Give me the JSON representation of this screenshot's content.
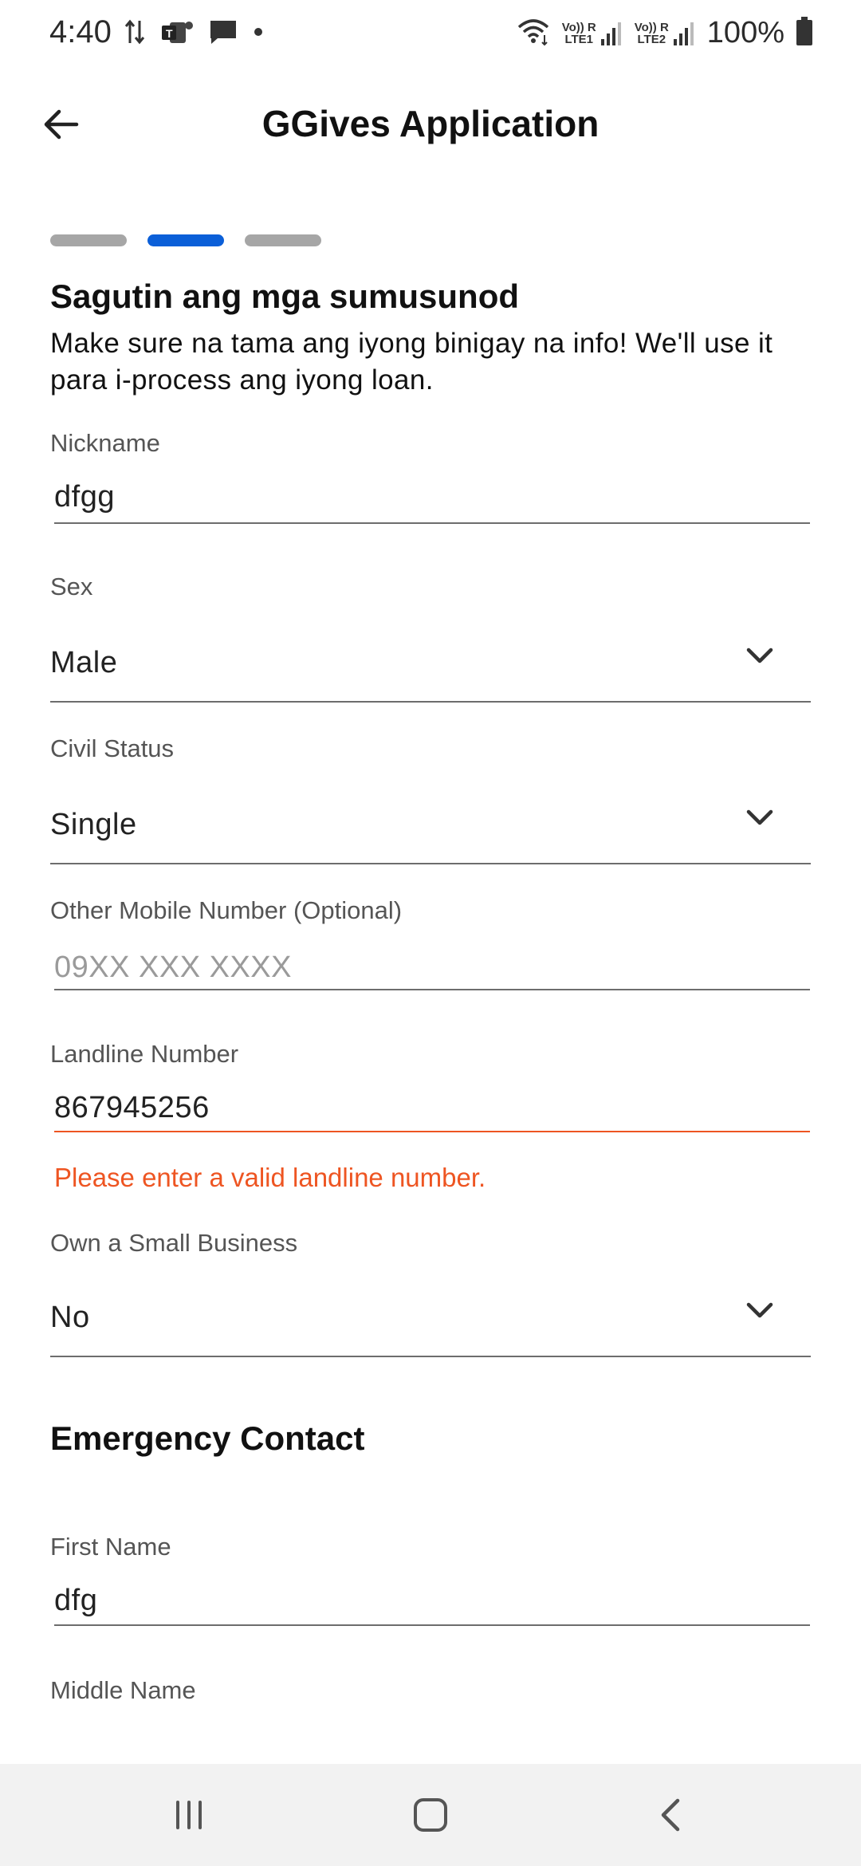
{
  "status_bar": {
    "time": "4:40",
    "battery": "100%",
    "sim1_label": "Vo)) R\nLTE1",
    "sim2_label": "Vo)) R\nLTE2",
    "left_icons": [
      "data-transfer-icon",
      "teams-icon",
      "message-icon",
      "dot-icon"
    ],
    "right_icons": [
      "wifi-icon",
      "signal-icon",
      "signal-icon",
      "battery-icon"
    ]
  },
  "app_bar": {
    "title": "GGives Application",
    "back_icon": "arrow-left-icon"
  },
  "stepper": {
    "steps": 3,
    "current": 2,
    "active_color": "#0b5fd8",
    "inactive_color": "#a6a6a6"
  },
  "intro": {
    "title": "Sagutin ang mga sumusunod",
    "description": "Make sure na tama ang iyong binigay na info! We'll use it para i-process ang iyong loan."
  },
  "form": {
    "nickname": {
      "label": "Nickname",
      "value": "dfgg"
    },
    "sex": {
      "label": "Sex",
      "value": "Male"
    },
    "civil_status": {
      "label": "Civil Status",
      "value": "Single"
    },
    "other_mobile": {
      "label": "Other Mobile Number (Optional)",
      "placeholder": "09XX XXX XXXX"
    },
    "landline": {
      "label": "Landline Number",
      "value": "867945256",
      "error": "Please enter a valid landline number."
    },
    "small_business": {
      "label": "Own a Small Business",
      "value": "No"
    }
  },
  "emergency": {
    "title": "Emergency Contact",
    "first_name": {
      "label": "First Name",
      "value": "dfg"
    },
    "middle_name": {
      "label": "Middle Name"
    }
  },
  "colors": {
    "error": "#ee5522",
    "accent": "#0b5fd8"
  },
  "nav_bar": {
    "icons": [
      "recent-apps-icon",
      "home-icon",
      "back-icon"
    ]
  }
}
